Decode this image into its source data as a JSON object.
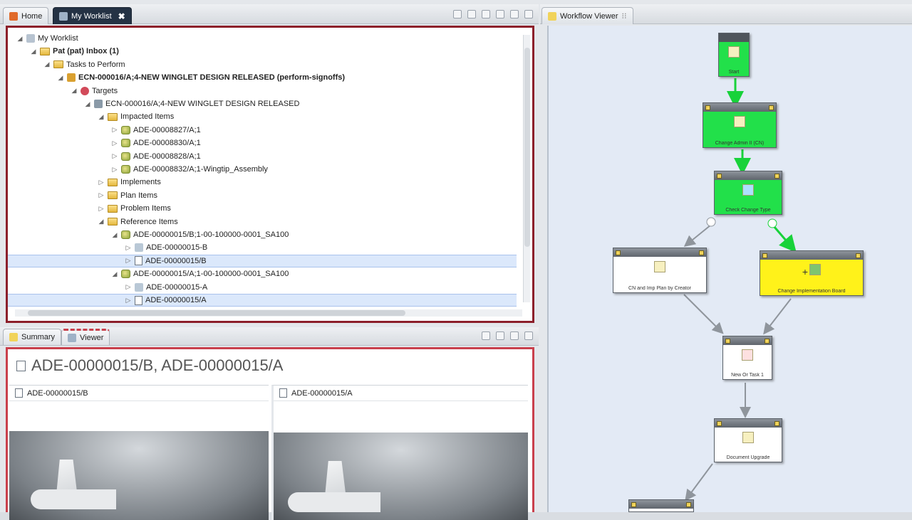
{
  "tabs": {
    "home": "Home",
    "worklist": "My Worklist",
    "close": "✖"
  },
  "tree": [
    {
      "label": "My Worklist",
      "level": 0,
      "icon": "worklist-icon",
      "tw": "◢",
      "bold": false
    },
    {
      "label": "Pat (pat) Inbox (1)",
      "level": 1,
      "icon": "folder-icon",
      "tw": "◢",
      "bold": true
    },
    {
      "label": "Tasks to Perform",
      "level": 2,
      "icon": "folder-icon",
      "tw": "◢",
      "bold": false
    },
    {
      "label": "ECN-000016/A;4-NEW WINGLET DESIGN RELEASED (perform-signoffs)",
      "level": 3,
      "icon": "task-icon",
      "tw": "◢",
      "bold": true
    },
    {
      "label": "Targets",
      "level": 4,
      "icon": "targets-icon",
      "tw": "◢",
      "bold": false
    },
    {
      "label": "ECN-000016/A;4-NEW WINGLET DESIGN RELEASED",
      "level": 5,
      "icon": "ecn-icon",
      "tw": "◢",
      "bold": false
    },
    {
      "label": "Impacted Items",
      "level": 6,
      "icon": "folder-icon",
      "tw": "◢",
      "bold": false
    },
    {
      "label": "ADE-00008827/A;1",
      "level": 7,
      "icon": "item-icon",
      "tw": "▷",
      "bold": false
    },
    {
      "label": "ADE-00008830/A;1",
      "level": 7,
      "icon": "item-icon",
      "tw": "▷",
      "bold": false
    },
    {
      "label": "ADE-00008828/A;1",
      "level": 7,
      "icon": "item-icon",
      "tw": "▷",
      "bold": false
    },
    {
      "label": "ADE-00008832/A;1-Wingtip_Assembly",
      "level": 7,
      "icon": "item-icon",
      "tw": "▷",
      "bold": false
    },
    {
      "label": "Implements",
      "level": 6,
      "icon": "folder-icon",
      "tw": "▷",
      "bold": false
    },
    {
      "label": "Plan Items",
      "level": 6,
      "icon": "folder-icon",
      "tw": "▷",
      "bold": false
    },
    {
      "label": "Problem Items",
      "level": 6,
      "icon": "folder-icon",
      "tw": "▷",
      "bold": false
    },
    {
      "label": "Reference Items",
      "level": 6,
      "icon": "folder-icon",
      "tw": "◢",
      "bold": false
    },
    {
      "label": "ADE-00000015/B;1-00-100000-0001_SA100",
      "level": 7,
      "icon": "item-icon",
      "tw": "◢",
      "bold": false
    },
    {
      "label": "ADE-00000015-B",
      "level": 8,
      "icon": "dataset-icon",
      "tw": "▷",
      "bold": false
    },
    {
      "label": "ADE-00000015/B",
      "level": 8,
      "icon": "revision-icon",
      "tw": "▷",
      "bold": false,
      "selected": true
    },
    {
      "label": "ADE-00000015/A;1-00-100000-0001_SA100",
      "level": 7,
      "icon": "item-icon",
      "tw": "◢",
      "bold": false
    },
    {
      "label": "ADE-00000015-A",
      "level": 8,
      "icon": "dataset-icon",
      "tw": "▷",
      "bold": false
    },
    {
      "label": "ADE-00000015/A",
      "level": 8,
      "icon": "revision-icon",
      "tw": "▷",
      "bold": false,
      "selected": true
    }
  ],
  "bottom_tabs": {
    "summary": "Summary",
    "viewer": "Viewer"
  },
  "viewer": {
    "title": "ADE-00000015/B, ADE-00000015/A",
    "left": "ADE-00000015/B",
    "right": "ADE-00000015/A"
  },
  "workflow": {
    "title": "Workflow Viewer",
    "nodes": [
      {
        "id": "start",
        "label": "Start",
        "color": "green"
      },
      {
        "id": "change-admin",
        "label": "Change Admin II (CN)",
        "color": "green"
      },
      {
        "id": "check-change-type",
        "label": "Check Change Type",
        "color": "green"
      },
      {
        "id": "cn-imp-plan",
        "label": "CN and Imp Plan by Creator",
        "color": "white"
      },
      {
        "id": "change-impl-board",
        "label": "Change Implementation Board",
        "color": "yellow"
      },
      {
        "id": "new-or-task",
        "label": "New Or Task 1",
        "color": "white"
      },
      {
        "id": "document-upgrade",
        "label": "Document Upgrade",
        "color": "white"
      }
    ],
    "colors": {
      "green": "#22e04a",
      "yellow": "#fff21a",
      "arrow_green": "#18d23a",
      "arrow_grey": "#8f959c"
    }
  }
}
